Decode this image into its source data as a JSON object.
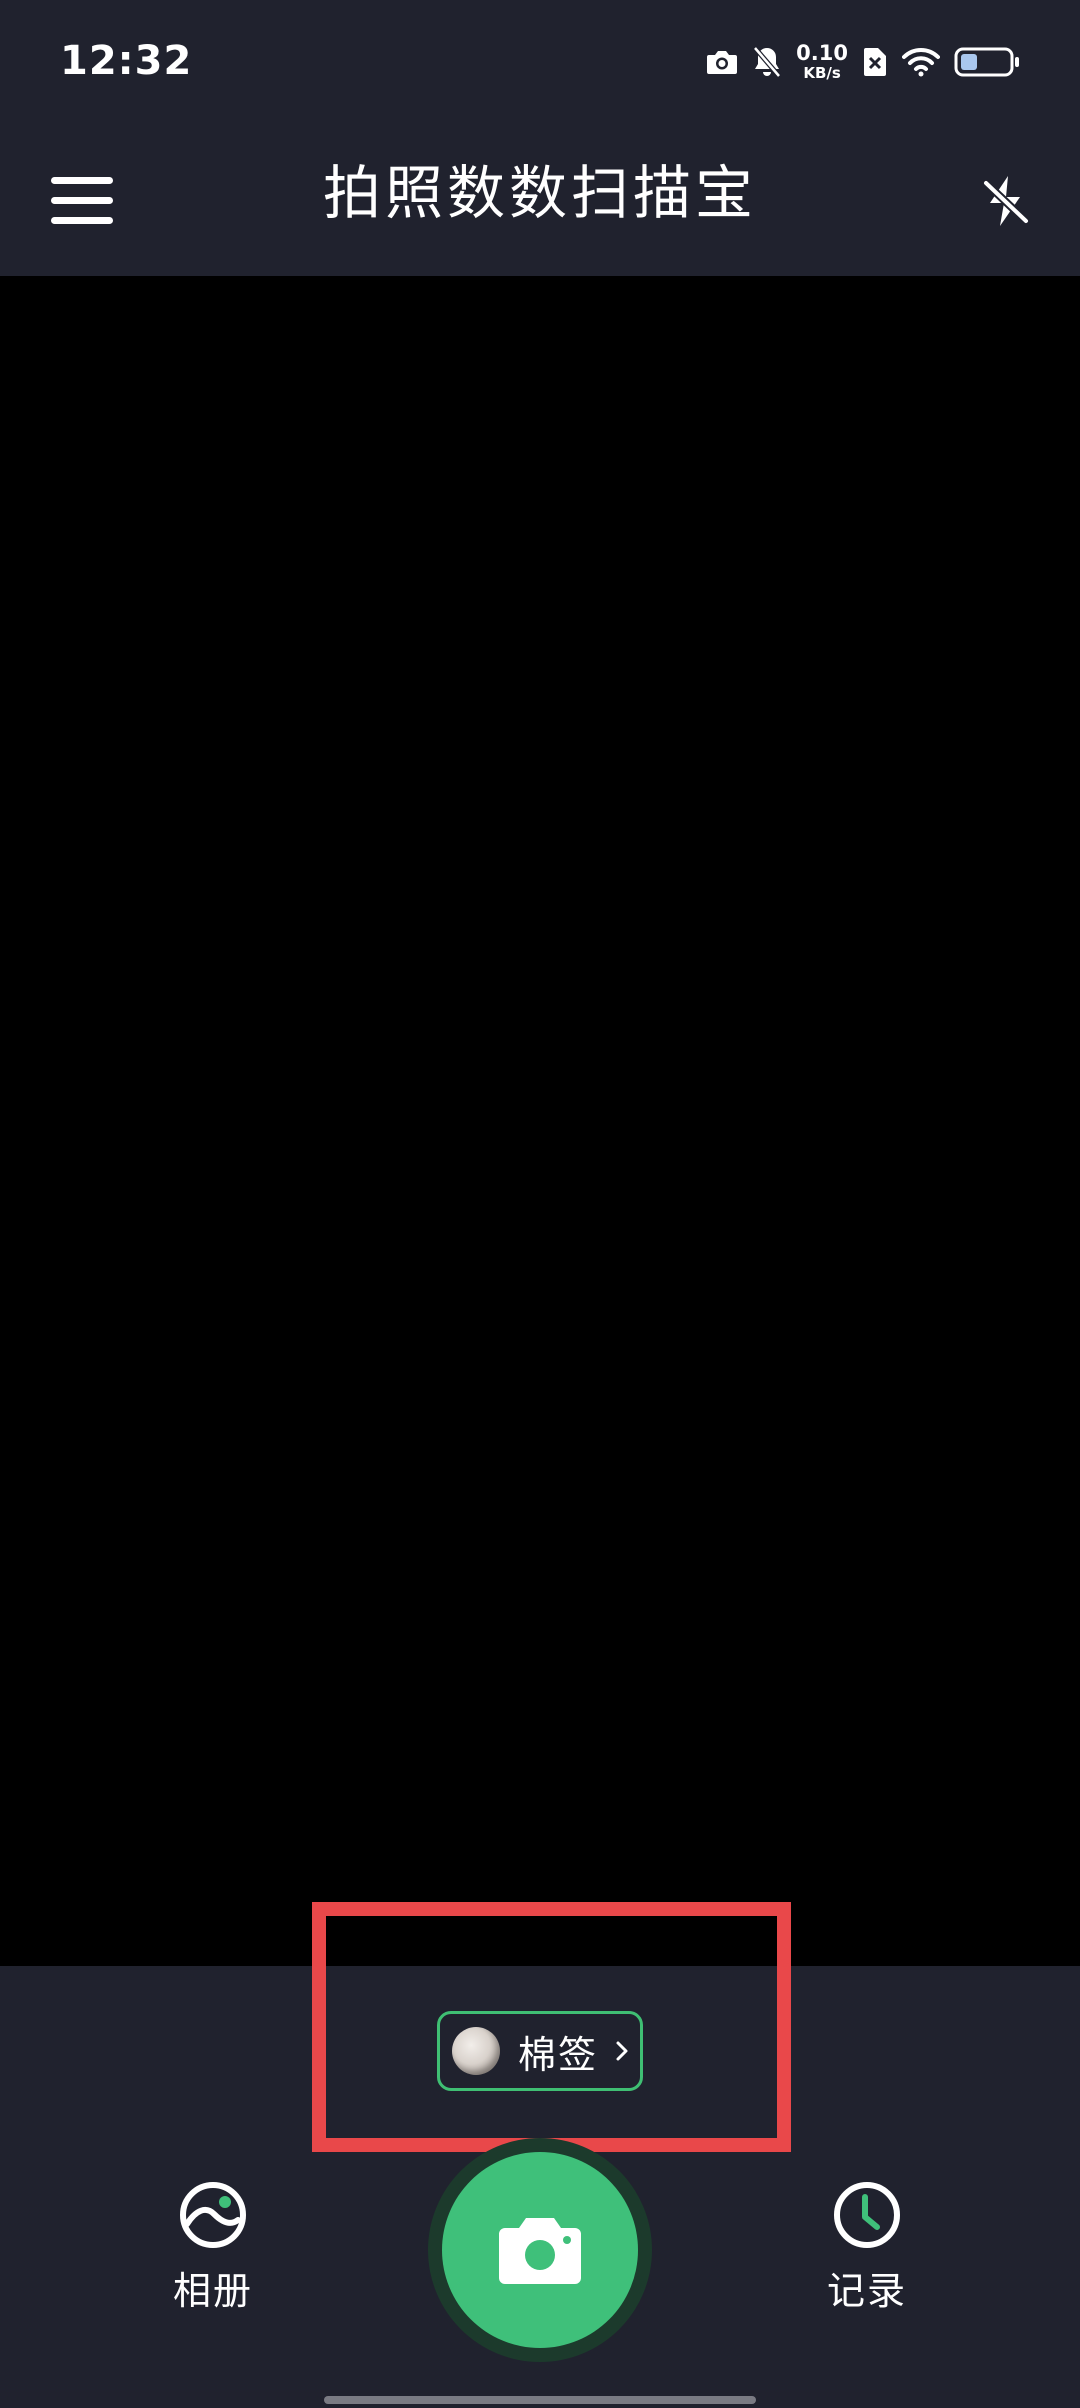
{
  "status_bar": {
    "time": "12:32",
    "net_speed_value": "0.10",
    "net_speed_unit": "KB/s",
    "icons": [
      "camera-icon",
      "bell-muted-icon",
      "sim-disabled-icon",
      "wifi-icon",
      "battery-icon"
    ],
    "battery_level": 0.35
  },
  "header": {
    "title": "拍照数数扫描宝",
    "menu_icon": "hamburger-menu-icon",
    "flash_icon": "flash-off-icon"
  },
  "object_selector": {
    "label": "棉签",
    "thumbnail_icon": "cotton-swab-thumbnail",
    "chevron_icon": "chevron-right-icon"
  },
  "bottom_nav": {
    "album_label": "相册",
    "album_icon": "album-icon",
    "history_label": "记录",
    "history_icon": "clock-icon",
    "shutter_icon": "camera-icon"
  },
  "colors": {
    "background": "#000000",
    "panel": "#20222e",
    "accent_green": "#3fc07a",
    "highlight_red": "#e9484a",
    "text": "#ffffff"
  }
}
